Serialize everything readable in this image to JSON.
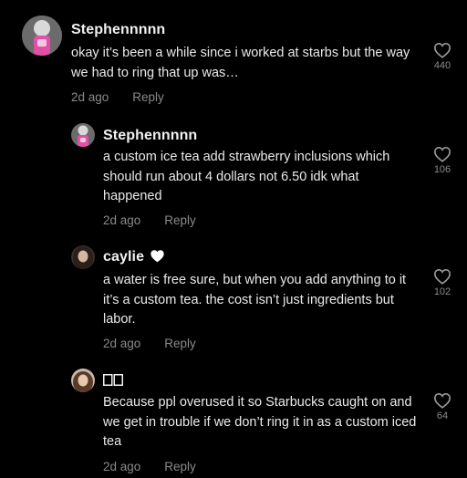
{
  "colors": {
    "background": "#000000",
    "username": "#f1f1f1",
    "text": "#eaeaea",
    "meta": "#8a8a8a"
  },
  "comments": [
    {
      "username": "Stephennnnn",
      "text": "okay it’s been a while since i worked at starbs but the way we had to ring that up was…",
      "time": "2d ago",
      "reply_label": "Reply",
      "likes": "440",
      "icon": "heart-outline-icon"
    },
    {
      "username": "Stephennnnn",
      "text": "a custom ice tea add strawberry inclusions which should run about 4 dollars not 6.50 idk what happened",
      "time": "2d ago",
      "reply_label": "Reply",
      "likes": "106",
      "icon": "heart-outline-icon"
    },
    {
      "username": "caylie",
      "text": "a water is free sure, but when you add anything to it it’s a custom tea. the cost isn’t just ingredients but labor.",
      "time": "2d ago",
      "reply_label": "Reply",
      "likes": "102",
      "icon": "heart-outline-icon"
    },
    {
      "username": "",
      "text": "Because ppl overused it so Starbucks caught on and we get in trouble if we don’t ring it in as a custom iced tea",
      "time": "2d ago",
      "reply_label": "Reply",
      "likes": "64",
      "icon": "heart-outline-icon"
    }
  ]
}
